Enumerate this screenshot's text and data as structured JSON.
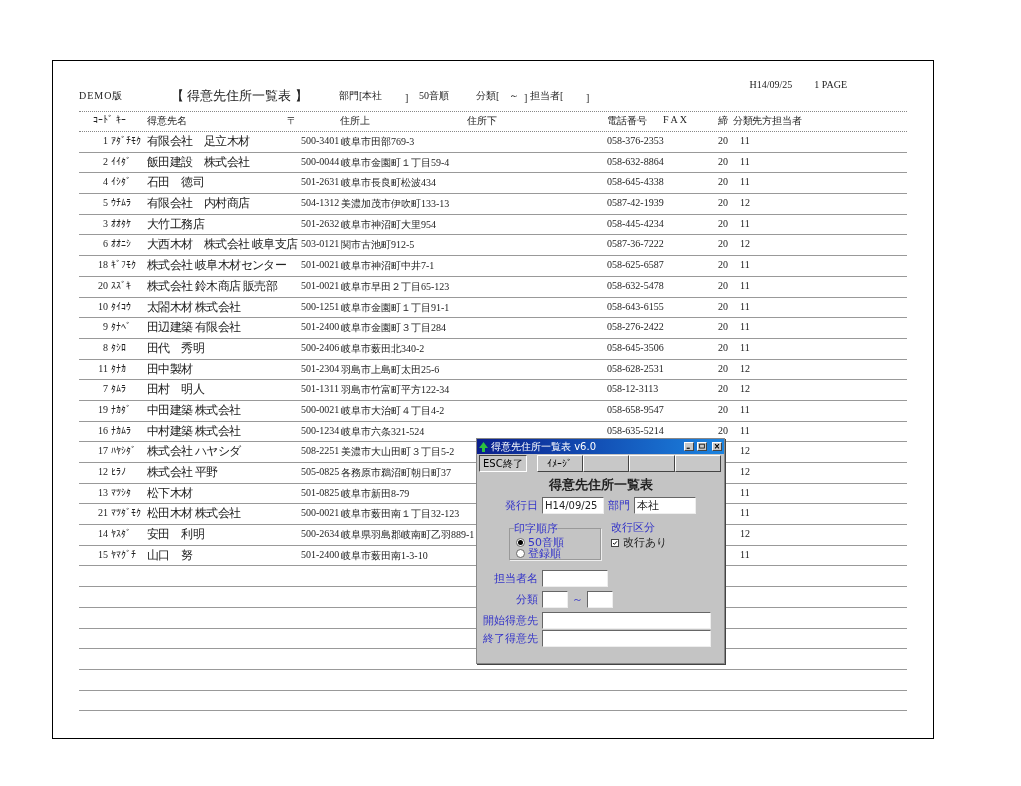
{
  "report": {
    "demo_label": "DEMO版",
    "title": "【 得意先住所一覧表 】",
    "dept_filter": "部門[本社",
    "dept_close": "]",
    "order": "50音順",
    "category_filter": "分類[",
    "category_tilde": "～",
    "category_close": "]",
    "staff_filter": "担当者[",
    "staff_close": "]",
    "date": "H14/09/25",
    "page": "1 PAGE"
  },
  "columns": [
    "ｺｰﾄﾞ ｷｰ",
    "得意先名",
    "〒",
    "住所上",
    "住所下",
    "電話番号",
    "F A X",
    "締",
    "分類",
    "先方担当者"
  ],
  "rows": [
    {
      "code": "1",
      "kana": "ｱﾀﾞﾁﾓｸ",
      "name": "有限会社　足立木材",
      "zip": "500-3401",
      "address": "岐阜市田部769-3",
      "phone": "058-376-2353",
      "closing": "20",
      "category": "11"
    },
    {
      "code": "2",
      "kana": "ｲｲﾀﾞ",
      "name": "飯田建設　株式会社",
      "zip": "500-0044",
      "address": "岐阜市金園町１丁目59-4",
      "phone": "058-632-8864",
      "closing": "20",
      "category": "11"
    },
    {
      "code": "4",
      "kana": "ｲｼﾀﾞ",
      "name": "石田　徳司",
      "zip": "501-2631",
      "address": "岐阜市長良町松波434",
      "phone": "058-645-4338",
      "closing": "20",
      "category": "11"
    },
    {
      "code": "5",
      "kana": "ｳﾁﾑﾗ",
      "name": "有限会社　内村商店",
      "zip": "504-1312",
      "address": "美濃加茂市伊吹町133-13",
      "phone": "0587-42-1939",
      "closing": "20",
      "category": "12"
    },
    {
      "code": "3",
      "kana": "ｵｵﾀｹ",
      "name": "大竹工務店",
      "zip": "501-2632",
      "address": "岐阜市神沼町大里954",
      "phone": "058-445-4234",
      "closing": "20",
      "category": "11"
    },
    {
      "code": "6",
      "kana": "ｵｵﾆｼ",
      "name": "大西木材　株式会社 岐阜支店",
      "zip": "503-0121",
      "address": "関市古池町912-5",
      "phone": "0587-36-7222",
      "closing": "20",
      "category": "12"
    },
    {
      "code": "18",
      "kana": "ｷﾞﾌﾓｸ",
      "name": "株式会社 岐阜木材センター",
      "zip": "501-0021",
      "address": "岐阜市神沼町中井7-1",
      "phone": "058-625-6587",
      "closing": "20",
      "category": "11"
    },
    {
      "code": "20",
      "kana": "ｽｽﾞｷ",
      "name": "株式会社 鈴木商店 販売部",
      "zip": "501-0021",
      "address": "岐阜市早田２丁目65-123",
      "phone": "058-632-5478",
      "closing": "20",
      "category": "11"
    },
    {
      "code": "10",
      "kana": "ﾀｲｺｳ",
      "name": "太閤木材 株式会社",
      "zip": "500-1251",
      "address": "岐阜市金園町１丁目91-1",
      "phone": "058-643-6155",
      "closing": "20",
      "category": "11"
    },
    {
      "code": "9",
      "kana": "ﾀﾅﾍﾞ",
      "name": "田辺建築 有限会社",
      "zip": "501-2400",
      "address": "岐阜市金園町３丁目284",
      "phone": "058-276-2422",
      "closing": "20",
      "category": "11"
    },
    {
      "code": "8",
      "kana": "ﾀｼﾛ",
      "name": "田代　秀明",
      "zip": "500-2406",
      "address": "岐阜市薮田北340-2",
      "phone": "058-645-3506",
      "closing": "20",
      "category": "11"
    },
    {
      "code": "11",
      "kana": "ﾀﾅｶ",
      "name": "田中製材",
      "zip": "501-2304",
      "address": "羽島市上島町太田25-6",
      "phone": "058-628-2531",
      "closing": "20",
      "category": "12"
    },
    {
      "code": "7",
      "kana": "ﾀﾑﾗ",
      "name": "田村　明人",
      "zip": "501-1311",
      "address": "羽島市竹富町平方122-34",
      "phone": "058-12-3113",
      "closing": "20",
      "category": "12"
    },
    {
      "code": "19",
      "kana": "ﾅｶﾀﾞ",
      "name": "中田建築 株式会社",
      "zip": "500-0021",
      "address": "岐阜市大治町４丁目4-2",
      "phone": "058-658-9547",
      "closing": "20",
      "category": "11"
    },
    {
      "code": "16",
      "kana": "ﾅｶﾑﾗ",
      "name": "中村建築 株式会社",
      "zip": "500-1234",
      "address": "岐阜市六条321-524",
      "phone": "058-635-5214",
      "closing": "20",
      "category": "11"
    },
    {
      "code": "17",
      "kana": "ﾊﾔｼﾀﾞ",
      "name": "株式会社 ハヤシダ",
      "zip": "508-2251",
      "address": "美濃市大山田町３丁目5-2",
      "category": "12"
    },
    {
      "code": "12",
      "kana": "ﾋﾗﾉ",
      "name": "株式会社 平野",
      "zip": "505-0825",
      "address": "各務原市鵜沼町朝日町37",
      "category": "12"
    },
    {
      "code": "13",
      "kana": "ﾏﾂｼﾀ",
      "name": "松下木材",
      "zip": "501-0825",
      "address": "岐阜市新田8-79",
      "category": "11"
    },
    {
      "code": "21",
      "kana": "ﾏﾂﾀﾞﾓｸ",
      "name": "松田木材 株式会社",
      "zip": "500-0021",
      "address": "岐阜市薮田南１丁目32-123",
      "category": "11"
    },
    {
      "code": "14",
      "kana": "ﾔｽﾀﾞ",
      "name": "安田　利明",
      "zip": "500-2634",
      "address": "岐阜県羽島郡岐南町乙羽889-1",
      "category": "12"
    },
    {
      "code": "15",
      "kana": "ﾔﾏｸﾞﾁ",
      "name": "山口　努",
      "zip": "501-2400",
      "address": "岐阜市薮田南1-3-10",
      "category": "11"
    }
  ],
  "dialog": {
    "title": "得意先住所一覧表 v6.0",
    "toolbar": [
      {
        "label": "ESC終了",
        "pressed": true
      },
      {
        "label": "ｲﾒｰｼﾞ",
        "pressed": false
      }
    ],
    "heading": "得意先住所一覧表",
    "issue_date_label": "発行日",
    "issue_date": "H14/09/25",
    "dept_label": "部門",
    "dept": "本社",
    "order_group": {
      "label": "印字順序",
      "options": [
        {
          "label": "50音順",
          "selected": true
        },
        {
          "label": "登録順",
          "selected": false
        }
      ]
    },
    "break_label": "改行区分",
    "break_check": {
      "label": "改行あり",
      "checked": true
    },
    "staff_label": "担当者名",
    "category_label": "分類",
    "category_tilde": "～",
    "start_label": "開始得意先",
    "end_label": "終了得意先"
  }
}
